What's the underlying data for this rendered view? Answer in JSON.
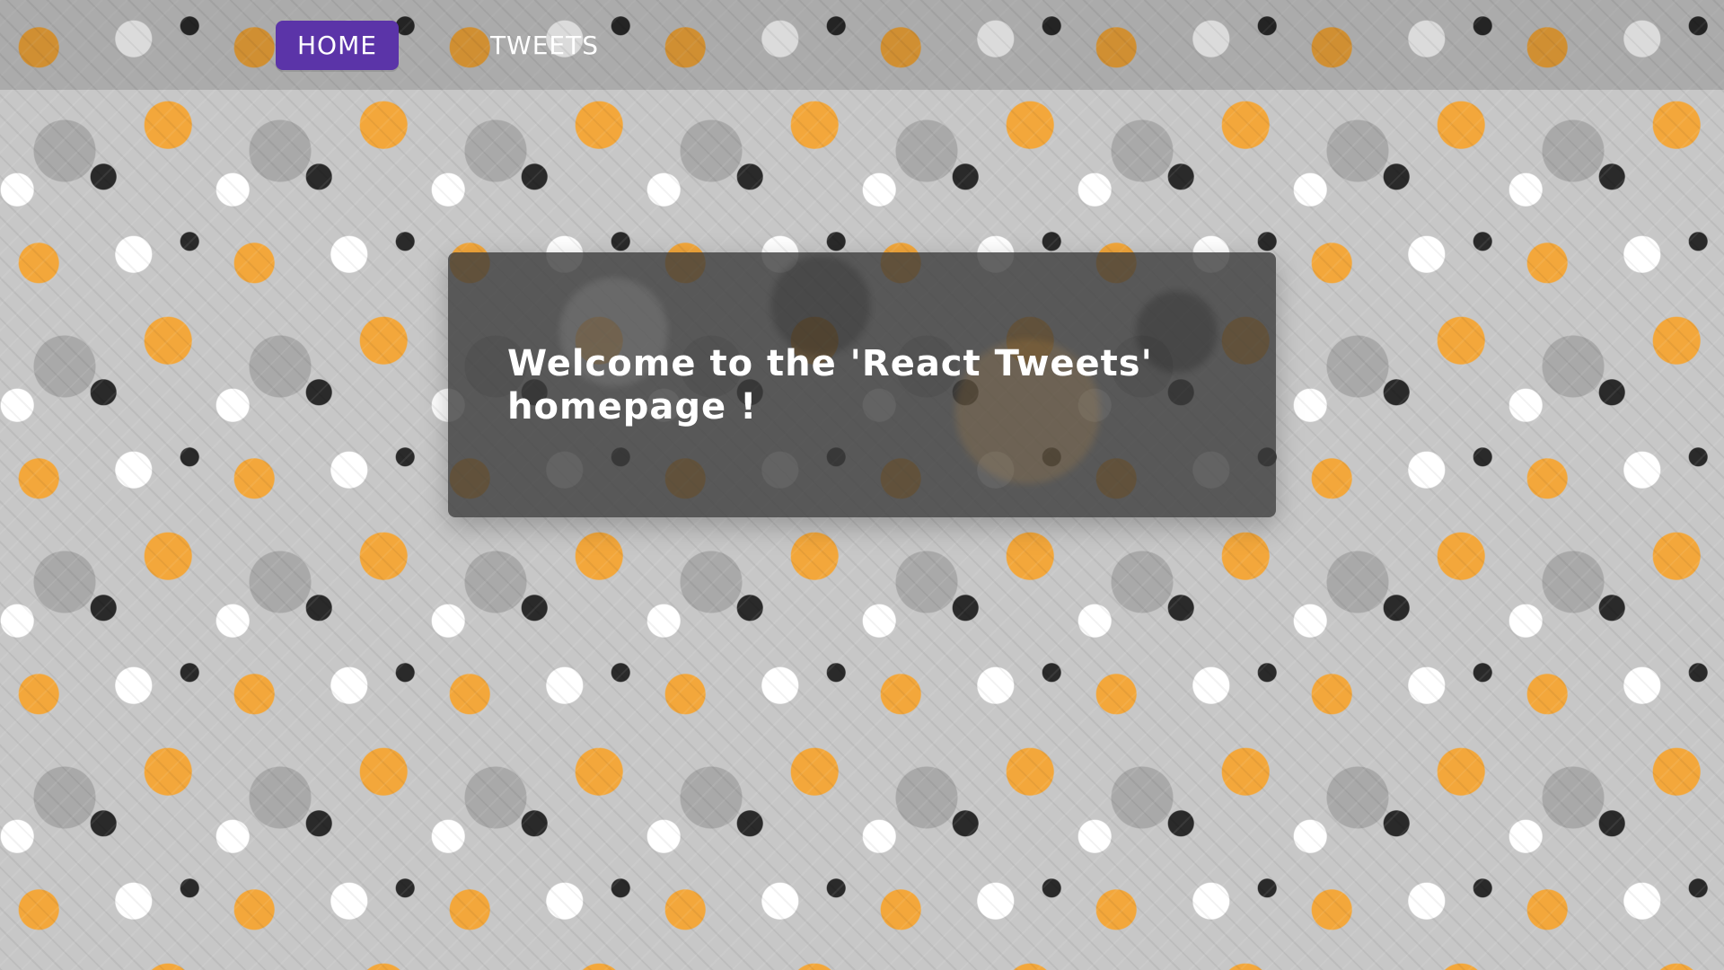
{
  "nav": {
    "items": [
      {
        "label": "HOME",
        "active": true
      },
      {
        "label": "TWEETS",
        "active": false
      }
    ]
  },
  "hero": {
    "title": "Welcome to the 'React Tweets' homepage !"
  },
  "theme": {
    "accent": "#5b34a8",
    "card_background": "#3c3c3c",
    "pattern_orange": "#f3a73b",
    "pattern_gray": "#c7c7c7",
    "pattern_black": "#2a2a2a"
  },
  "background": {
    "icon_name": "cat-pattern-icon"
  }
}
